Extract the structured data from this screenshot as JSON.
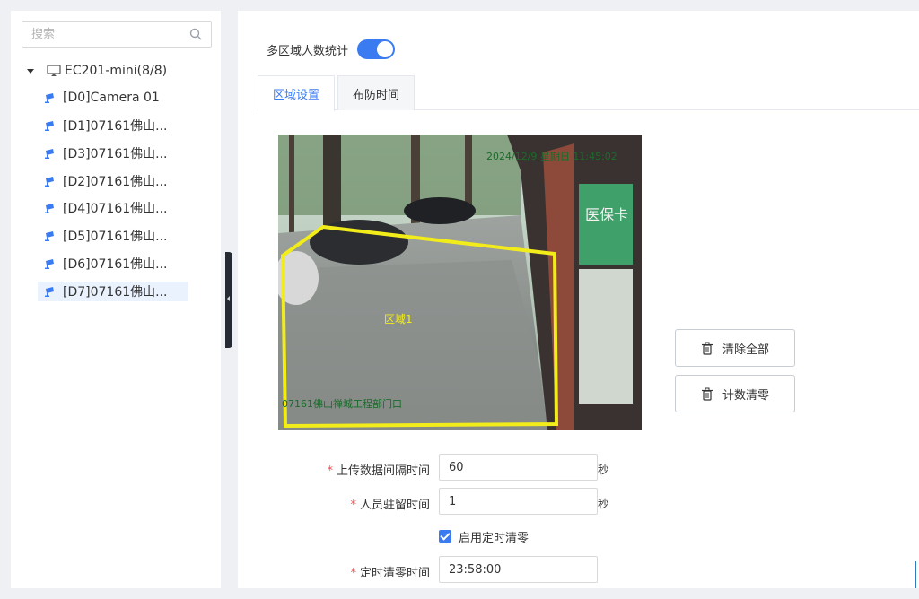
{
  "sidebar": {
    "search": {
      "placeholder": "搜索"
    },
    "root": {
      "label": "EC201-mini(8/8)"
    },
    "items": [
      {
        "label": "[D0]Camera 01"
      },
      {
        "label": "[D1]07161佛山..."
      },
      {
        "label": "[D3]07161佛山..."
      },
      {
        "label": "[D2]07161佛山..."
      },
      {
        "label": "[D4]07161佛山..."
      },
      {
        "label": "[D5]07161佛山..."
      },
      {
        "label": "[D6]07161佛山..."
      },
      {
        "label": "[D7]07161佛山..."
      }
    ],
    "selected_index": 7
  },
  "main": {
    "toggle": {
      "label": "多区域人数统计",
      "on": true
    },
    "tabs": [
      {
        "label": "区域设置",
        "active": true
      },
      {
        "label": "布防时间",
        "active": false
      }
    ],
    "video": {
      "timestamp": "2024/12/9 星期日 11:45:02",
      "osd_name": "07161佛山禅城工程部门口",
      "region_label": "区域1",
      "shop_sign": "医保卡"
    },
    "buttons": {
      "clear_all": "清除全部",
      "reset_count": "计数清零"
    },
    "form": {
      "upload_interval": {
        "label": "上传数据间隔时间",
        "value": "60",
        "unit": "秒"
      },
      "dwell_time": {
        "label": "人员驻留时间",
        "value": "1",
        "unit": "秒"
      },
      "timed_reset": {
        "label": "启用定时清零",
        "checked": true
      },
      "reset_time": {
        "label": "定时清零时间",
        "value": "23:58:00"
      }
    }
  },
  "colors": {
    "accent": "#3a7bf2",
    "required": "#f24a4a",
    "region": "#f2ec1a",
    "selected_bg": "#eaf2fe",
    "page_bg": "#eef0f4"
  }
}
